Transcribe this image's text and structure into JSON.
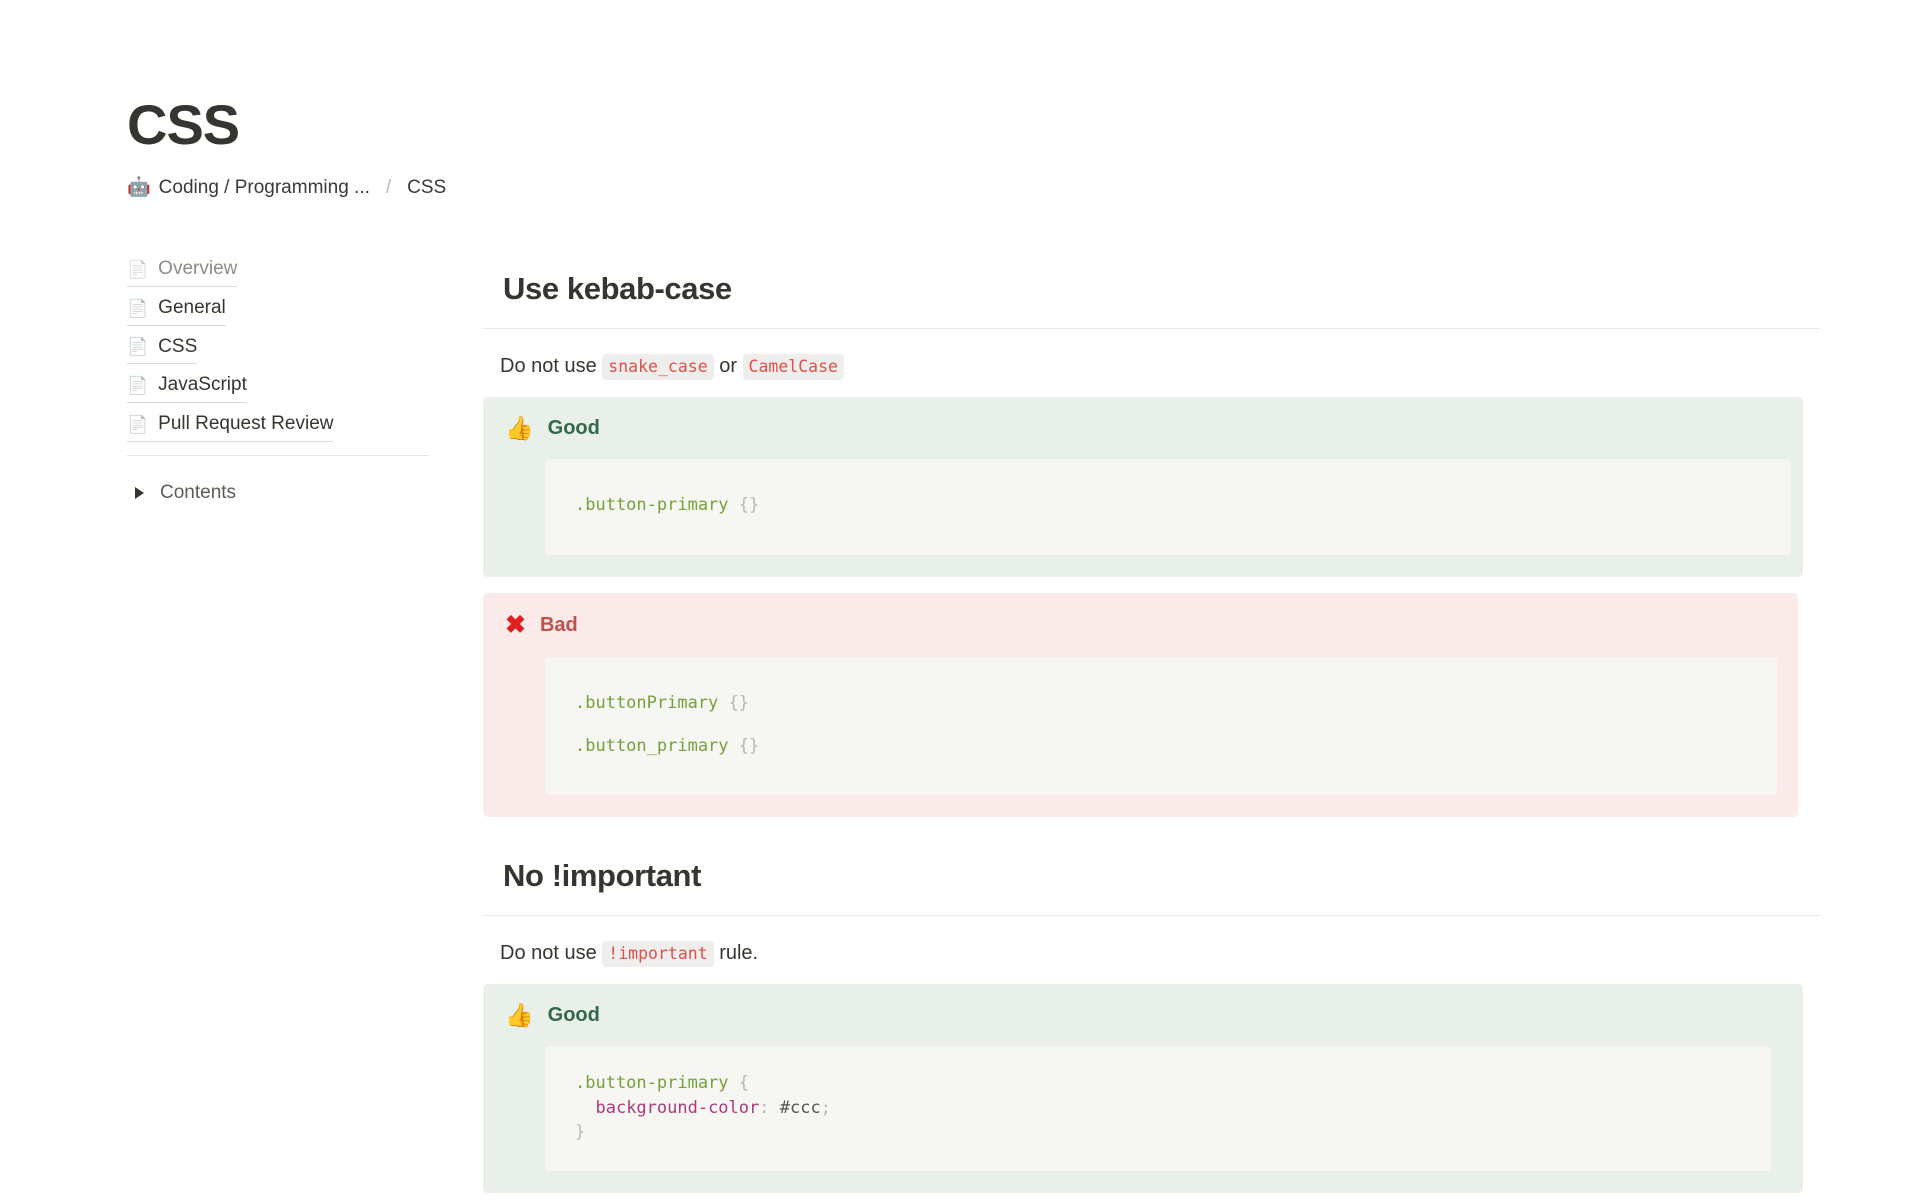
{
  "header": {
    "title": "CSS",
    "breadcrumb": {
      "emoji": "🤖",
      "parent": "Coding / Programming ...",
      "separator": "/",
      "current": "CSS"
    }
  },
  "sidebar": {
    "items": [
      {
        "emoji": "📄",
        "label": "Overview",
        "current": true
      },
      {
        "emoji": "📄",
        "label": "General",
        "current": false
      },
      {
        "emoji": "📄",
        "label": "CSS",
        "current": false
      },
      {
        "emoji": "📄",
        "label": "JavaScript",
        "current": false
      },
      {
        "emoji": "📄",
        "label": "Pull Request Review",
        "current": false
      }
    ],
    "contents": {
      "label": "Contents",
      "expanded": false
    }
  },
  "main": {
    "sections": [
      {
        "heading": "Use kebab-case",
        "paragraph": {
          "before": "Do not use ",
          "code1": "snake_case",
          "middle": " or ",
          "code2": "CamelCase",
          "after": ""
        },
        "callouts": [
          {
            "type": "good",
            "icon": "👍",
            "label": "Good",
            "code": {
              "lines": [
                {
                  "selector": ".button-primary",
                  "punct": " {}"
                }
              ]
            }
          },
          {
            "type": "bad",
            "icon": "✖",
            "label": "Bad",
            "code": {
              "lines": [
                {
                  "selector": ".buttonPrimary",
                  "punct": " {}"
                },
                {
                  "selector": ".button_primary",
                  "punct": " {}"
                }
              ]
            }
          }
        ]
      },
      {
        "heading": "No !important",
        "paragraph": {
          "before": "Do not use ",
          "code1": "!important",
          "middle": " rule.",
          "code2": "",
          "after": ""
        },
        "callouts": [
          {
            "type": "good",
            "icon": "👍",
            "label": "Good",
            "code": {
              "rule_selector": ".button-primary",
              "rule_open": " {",
              "rule_property": "background-color",
              "rule_colon": ": ",
              "rule_value": "#ccc",
              "rule_semicolon": ";",
              "rule_close": "}"
            }
          }
        ]
      }
    ]
  },
  "colors": {
    "good_bg": "#e9efe9",
    "bad_bg": "#fbeaea",
    "code_bg": "#f6f6f3",
    "good_text": "#34684b",
    "bad_text": "#c0504c",
    "inline_code_text": "#e0504a",
    "inline_code_bg": "#efeeec",
    "selector": "#76a03a",
    "property": "#b0377c",
    "text": "#37352f"
  }
}
